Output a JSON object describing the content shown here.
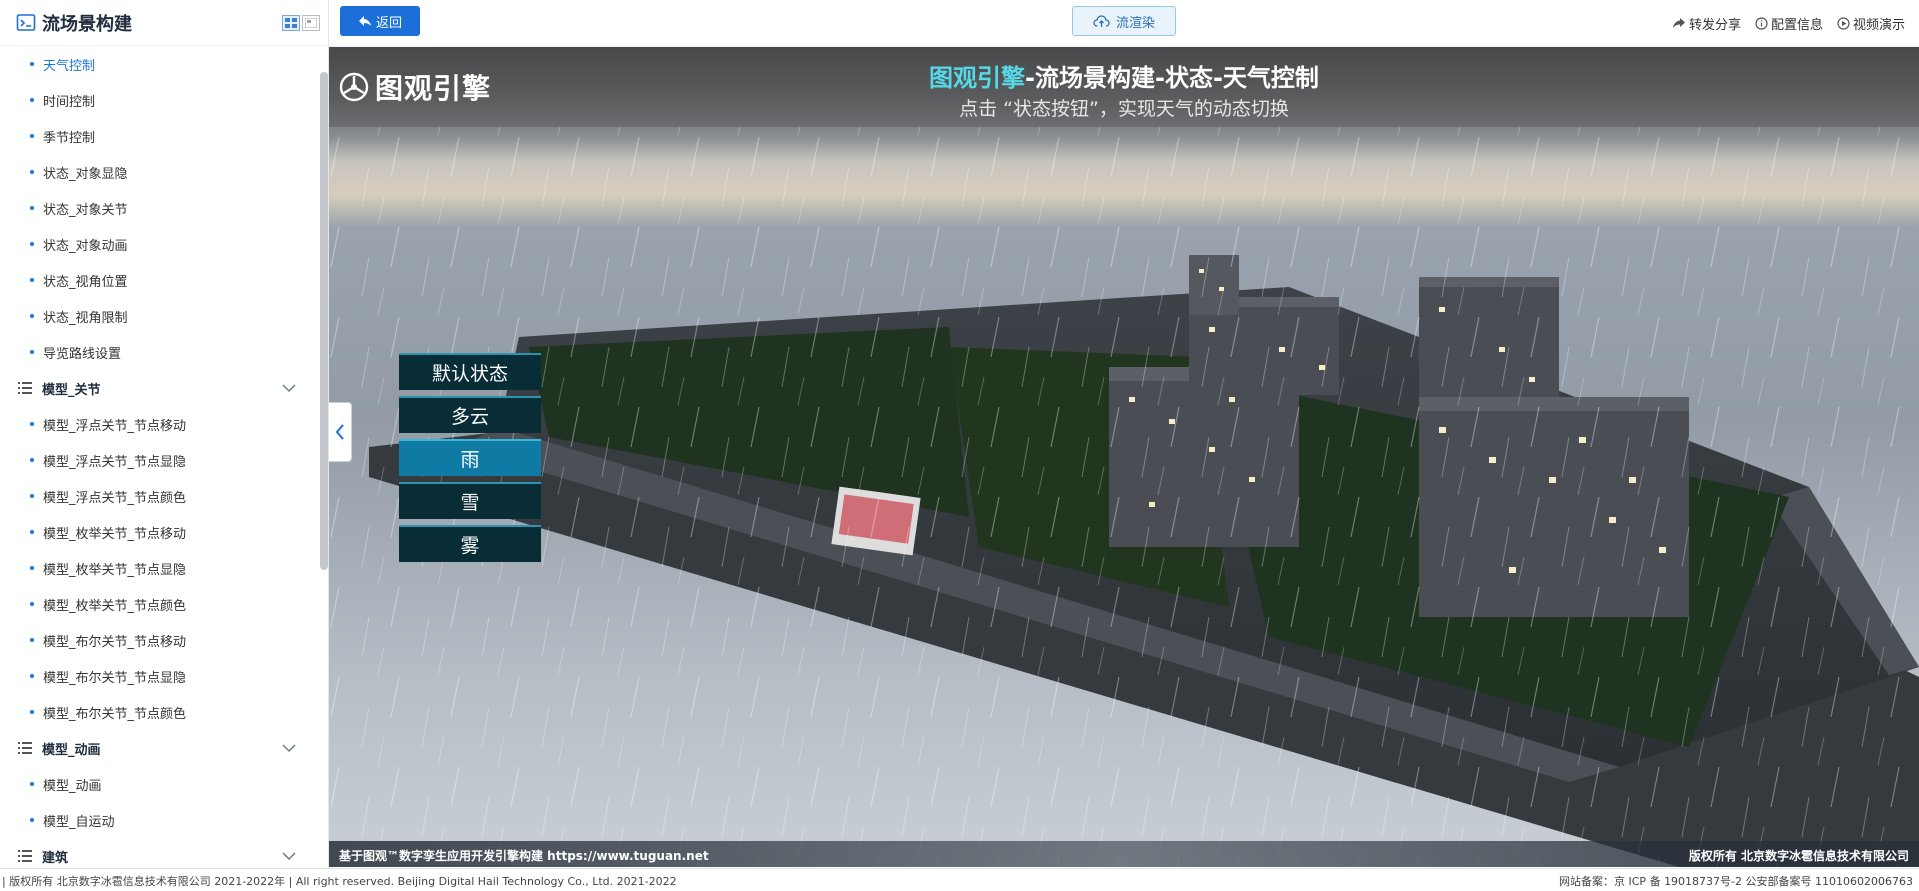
{
  "sidebar": {
    "title": "流场景构建",
    "items_top": [
      {
        "label": "天气控制",
        "active": true
      },
      {
        "label": "时间控制"
      },
      {
        "label": "季节控制"
      },
      {
        "label": "状态_对象显隐"
      },
      {
        "label": "状态_对象关节"
      },
      {
        "label": "状态_对象动画"
      },
      {
        "label": "状态_视角位置"
      },
      {
        "label": "状态_视角限制"
      },
      {
        "label": "导览路线设置"
      }
    ],
    "group_joint": {
      "label": "模型_关节",
      "items": [
        {
          "label": "模型_浮点关节_节点移动"
        },
        {
          "label": "模型_浮点关节_节点显隐"
        },
        {
          "label": "模型_浮点关节_节点颜色"
        },
        {
          "label": "模型_枚举关节_节点移动"
        },
        {
          "label": "模型_枚举关节_节点显隐"
        },
        {
          "label": "模型_枚举关节_节点颜色"
        },
        {
          "label": "模型_布尔关节_节点移动"
        },
        {
          "label": "模型_布尔关节_节点显隐"
        },
        {
          "label": "模型_布尔关节_节点颜色"
        }
      ]
    },
    "group_anim": {
      "label": "模型_动画",
      "items": [
        {
          "label": "模型_动画"
        },
        {
          "label": "模型_自运动"
        }
      ]
    },
    "group_build": {
      "label": "建筑"
    }
  },
  "topbar": {
    "back_label": "返回",
    "render_label": "流渲染",
    "share_label": "转发分享",
    "config_label": "配置信息",
    "video_label": "视频演示"
  },
  "viewport": {
    "brand": "图观引擎",
    "title_highlight": "图观引擎",
    "title_rest": "-流场景构建-状态-天气控制",
    "subtitle": "点击 “状态按钮”，实现天气的动态切换",
    "weather_buttons": [
      {
        "label": "默认状态"
      },
      {
        "label": "多云"
      },
      {
        "label": "雨",
        "active": true
      },
      {
        "label": "雪"
      },
      {
        "label": "雾"
      }
    ],
    "footer_left": "基于图观™数字孪生应用开发引擎构建 https://www.tuguan.net",
    "footer_right": "版权所有 北京数字冰雹信息技术有限公司"
  },
  "bottombar": {
    "left": "| 版权所有 北京数字冰雹信息技术有限公司 2021-2022年 | All right reserved. Beijing Digital Hail Technology Co., Ltd. 2021-2022",
    "right": "网站备案：京 ICP 备 19018737号-2 公安部备案号 11010602006763"
  },
  "colors": {
    "accent": "#1c6fd8",
    "title_highlight": "#56d9e6",
    "weather_btn": "#082d36",
    "weather_btn_active": "#0f7ba5"
  },
  "icons": [
    "sidebar-logo-icon",
    "grid-view-icon",
    "list-view-icon",
    "back-arrow-icon",
    "cloud-upload-icon",
    "share-icon",
    "info-icon",
    "play-icon",
    "chevron-left-icon",
    "chevron-down-icon",
    "list-icon",
    "tuguan-logo-icon"
  ]
}
